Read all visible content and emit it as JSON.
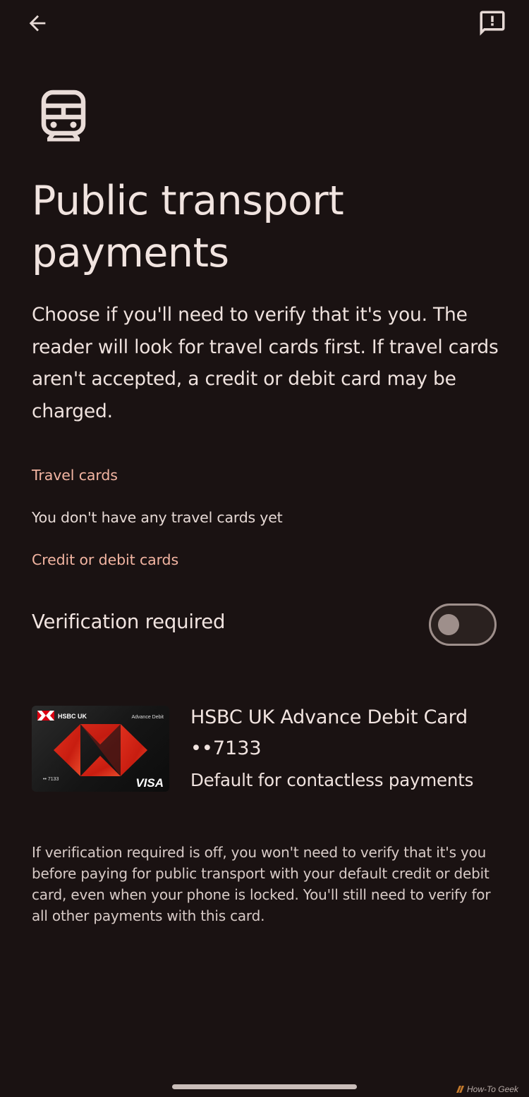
{
  "header": {
    "back_icon": "arrow-back-icon",
    "feedback_icon": "feedback-icon"
  },
  "hero": {
    "icon": "train-icon",
    "title": "Public transport payments",
    "intro": "Choose if you'll need to verify that it's you. The reader will look for travel cards first. If travel cards aren't accepted, a credit or debit card may be charged."
  },
  "travel_cards": {
    "label": "Travel cards",
    "empty_text": "You don't have any travel cards yet"
  },
  "credit_cards": {
    "label": "Credit or debit cards",
    "verification_label": "Verification required",
    "verification_enabled": false
  },
  "card": {
    "name": "HSBC UK Advance Debit Card",
    "number": "••7133",
    "status": "Default for contactless payments",
    "art": {
      "bank": "HSBC UK",
      "tier": "Advance Debit",
      "masked": "•• 7133",
      "network": "VISA"
    }
  },
  "footnote": "If verification required is off, you won't need to verify that it's you before paying for public transport with your default credit or debit card, even when your phone is locked. You'll still need to verify for all other payments with this card.",
  "watermark": "How-To Geek",
  "colors": {
    "background": "#1a1212",
    "accent_label": "#f3b5a2",
    "text": "#f1e4e0"
  }
}
